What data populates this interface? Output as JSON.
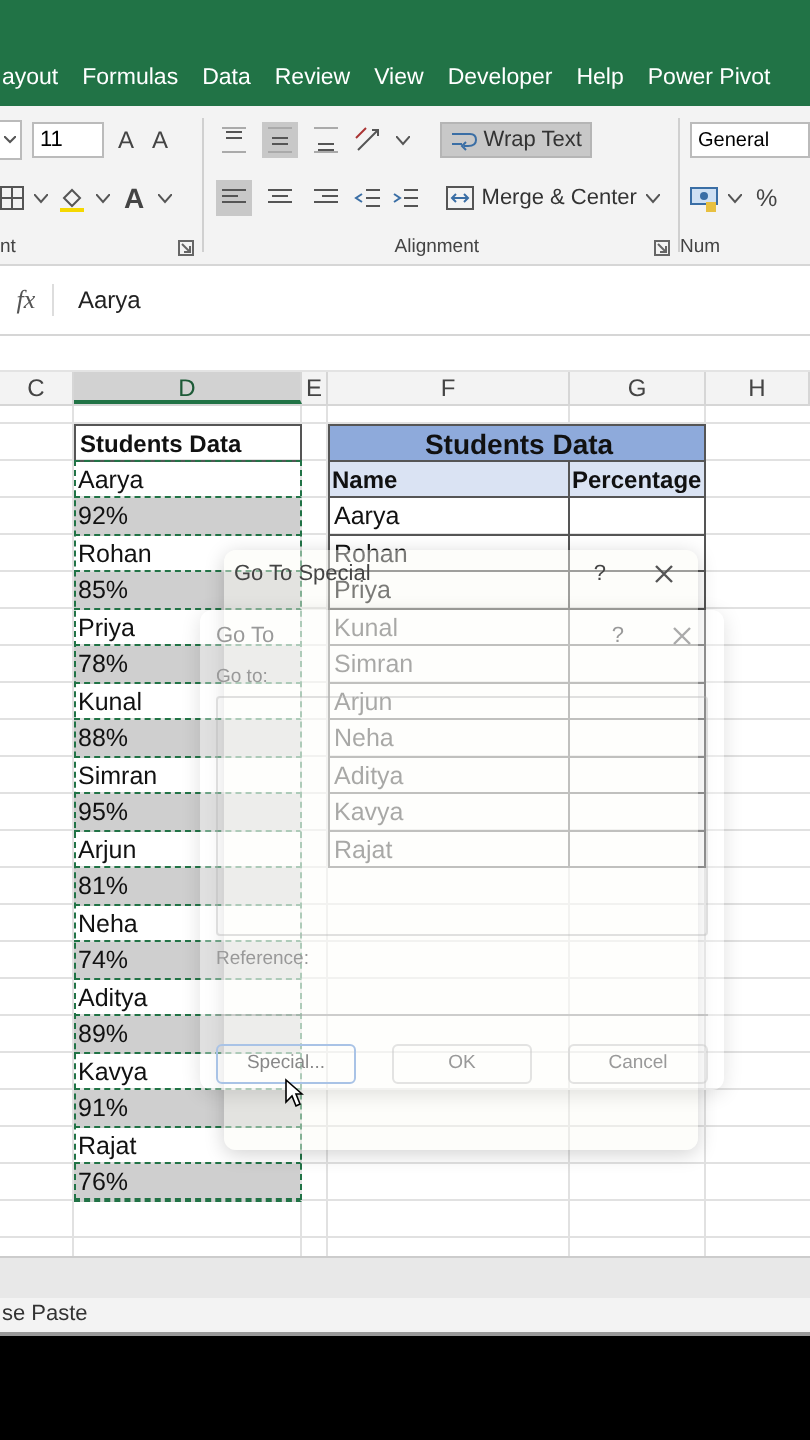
{
  "ribbon_tabs": [
    "ayout",
    "Formulas",
    "Data",
    "Review",
    "View",
    "Developer",
    "Help",
    "Power Pivot"
  ],
  "ribbon": {
    "font": {
      "size": "11",
      "grow_glyph": "A",
      "shrink_glyph": "A",
      "color_glyph": "A",
      "group_label": "nt"
    },
    "alignment": {
      "vertical": [
        {
          "kind": "top",
          "selected": false
        },
        {
          "kind": "middle",
          "selected": true
        },
        {
          "kind": "bottom",
          "selected": false
        }
      ],
      "horizontal": [
        {
          "kind": "left",
          "selected": true
        },
        {
          "kind": "center",
          "selected": false
        },
        {
          "kind": "right",
          "selected": false
        }
      ],
      "wrap_text": {
        "label": "Wrap Text",
        "on": true
      },
      "merge_center": {
        "label": "Merge & Center"
      },
      "group_label": "Alignment"
    },
    "number": {
      "format": "General",
      "percent_glyph": "%",
      "group_label": "Num"
    }
  },
  "formula_bar": {
    "fx": "fx",
    "value": "Aarya"
  },
  "columns": [
    {
      "label": "C",
      "selected": false
    },
    {
      "label": "D",
      "selected": true
    },
    {
      "label": "E",
      "selected": false
    },
    {
      "label": "F",
      "selected": false
    },
    {
      "label": "G",
      "selected": false
    },
    {
      "label": "H",
      "selected": false
    }
  ],
  "column_d": {
    "header": "Students Data",
    "cells": [
      {
        "text": "Aarya",
        "selected": false
      },
      {
        "text": "92%",
        "selected": true
      },
      {
        "text": "Rohan",
        "selected": false
      },
      {
        "text": "85%",
        "selected": true
      },
      {
        "text": "Priya",
        "selected": false
      },
      {
        "text": "78%",
        "selected": true
      },
      {
        "text": "Kunal",
        "selected": false
      },
      {
        "text": "88%",
        "selected": true
      },
      {
        "text": "Simran",
        "selected": false
      },
      {
        "text": "95%",
        "selected": true
      },
      {
        "text": "Arjun",
        "selected": false
      },
      {
        "text": "81%",
        "selected": true
      },
      {
        "text": "Neha",
        "selected": false
      },
      {
        "text": "74%",
        "selected": true
      },
      {
        "text": "Aditya",
        "selected": false
      },
      {
        "text": "89%",
        "selected": true
      },
      {
        "text": "Kavya",
        "selected": false
      },
      {
        "text": "91%",
        "selected": true
      },
      {
        "text": "Rajat",
        "selected": false
      },
      {
        "text": "76%",
        "selected": true
      }
    ]
  },
  "table": {
    "title": "Students Data",
    "columns": [
      "Name",
      "Percentage"
    ],
    "rows": [
      "Aarya",
      "Rohan",
      "Priya",
      "Kunal",
      "Simran",
      "Arjun",
      "Neha",
      "Aditya",
      "Kavya",
      "Rajat"
    ]
  },
  "go_to_special_dialog": {
    "title": "Go To Special",
    "help": "?"
  },
  "go_to_dialog": {
    "title": "Go To",
    "help": "?",
    "go_to_label": "Go to:",
    "reference_label": "Reference:",
    "buttons": [
      "Special...",
      "OK",
      "Cancel"
    ]
  },
  "status_bar": {
    "text": "se Paste"
  }
}
